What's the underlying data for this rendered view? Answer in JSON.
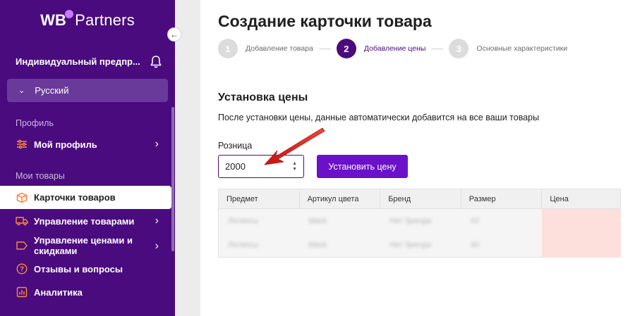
{
  "sidebar": {
    "logo_a": "WB",
    "logo_b": "Partners",
    "org_name": "Индивидуальный предпр...",
    "language": "Русский",
    "sections": {
      "profile": "Профиль",
      "my_goods": "Мои товары"
    },
    "items": [
      {
        "label": "Мой профиль",
        "icon": "sliders-icon"
      },
      {
        "label": "Карточки товаров",
        "icon": "box-icon"
      },
      {
        "label": "Управление товарами",
        "icon": "truck-icon"
      },
      {
        "label_1": "Управление ценами и",
        "label_2": "скидками",
        "icon": "tag-icon"
      },
      {
        "label": "Отзывы и вопросы",
        "icon": "question-icon"
      },
      {
        "label": "Аналитика",
        "icon": "chart-icon"
      }
    ],
    "active_item": "Карточки товаров"
  },
  "main": {
    "title": "Создание карточки товара",
    "steps": [
      {
        "num": "1",
        "label": "Добавление товара"
      },
      {
        "num": "2",
        "label": "Добавление цены",
        "active": true
      },
      {
        "num": "3",
        "label": "Основные характеристики"
      }
    ],
    "section_title": "Установка цены",
    "description": "После установки цены, данные автоматически добавится на все ваши товары",
    "retail_label": "Розница",
    "retail_value": "2000",
    "set_price_button": "Установить цену",
    "table": {
      "headers": [
        "Предмет",
        "Артикул цвета",
        "Бренд",
        "Размер",
        "Цена"
      ],
      "rows": [
        [
          "Легинсы",
          "black",
          "Нет бренда",
          "42",
          ""
        ],
        [
          "Легинсы",
          "black",
          "Нет бренда",
          "40",
          ""
        ]
      ]
    }
  },
  "colors": {
    "sidebar_bg": "#4a0b7f",
    "accent": "#6a11c9",
    "price_cell": "#fde0db",
    "annotation_arrow": "#e02020"
  }
}
